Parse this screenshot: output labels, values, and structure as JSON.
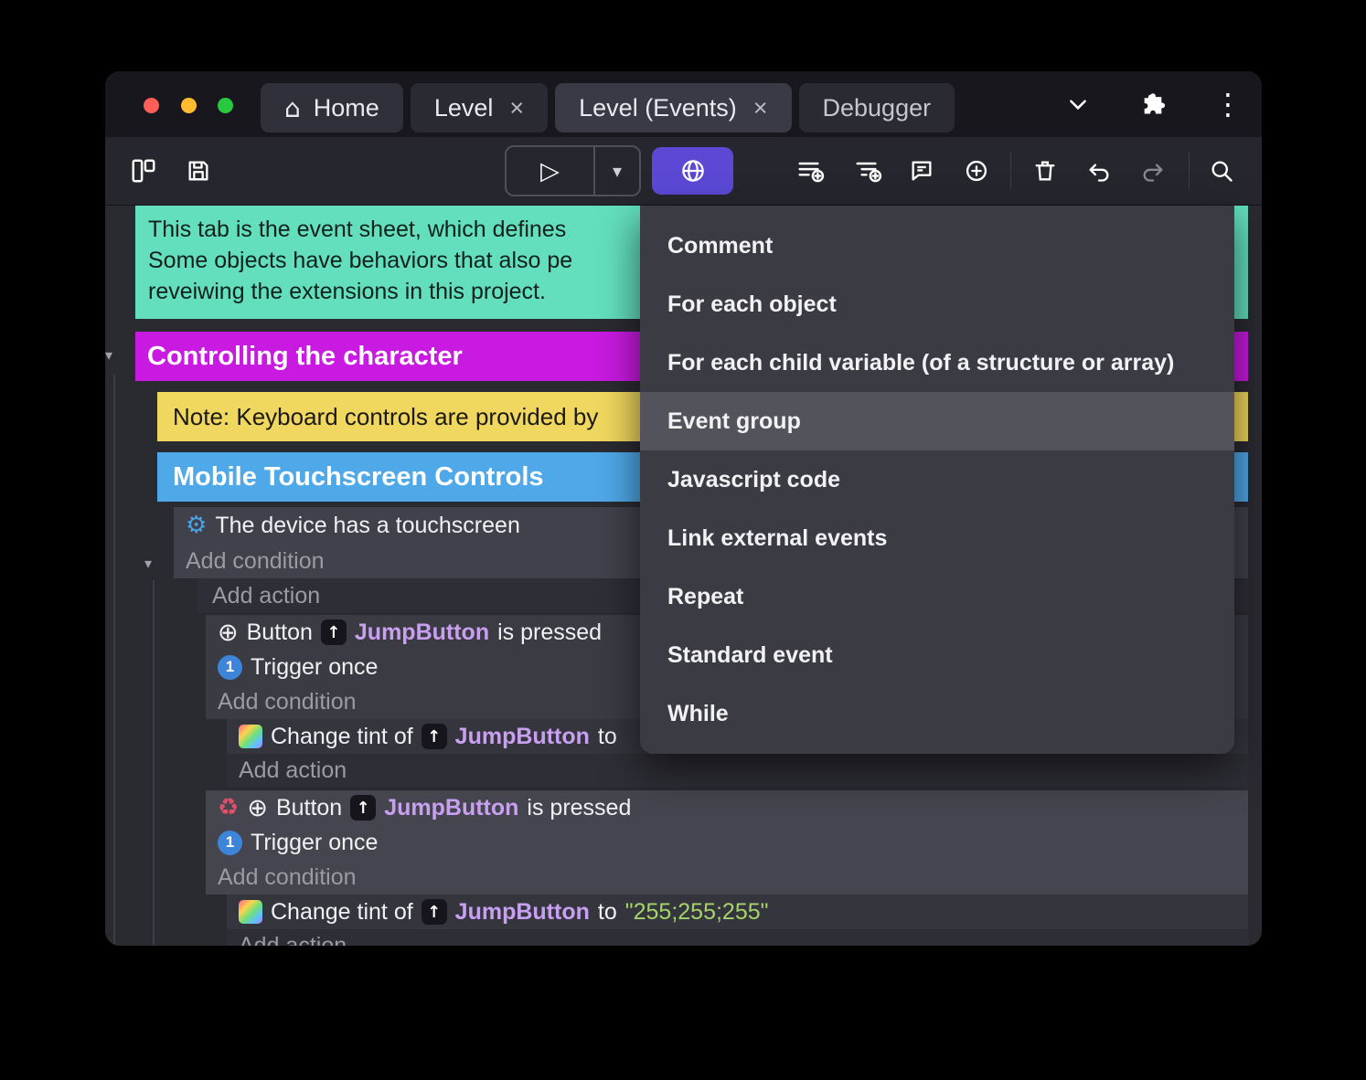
{
  "colors": {
    "accent": "#5b49d6",
    "comment-bg": "#63dfbd",
    "group1-bg": "#c81ae0",
    "note-bg": "#f0d75f",
    "group2-bg": "#4fa8e8",
    "object-text": "#c9a0f0",
    "string-text": "#a5d46a"
  },
  "icons": {
    "home": "⌂",
    "close": "×",
    "kebab": "⋮",
    "play": "▷",
    "dropdown": "▾",
    "caret": "▾",
    "gear": "⚙",
    "crosshair": "⊕",
    "uparrow": "↑",
    "one": "1",
    "recycle": "♻"
  },
  "titlebar": {
    "tabs": [
      {
        "label": "Home"
      },
      {
        "label": "Level"
      },
      {
        "label": "Level (Events)"
      },
      {
        "label": "Debugger"
      }
    ]
  },
  "menu": {
    "items": [
      "Comment",
      "For each object",
      "For each child variable (of a structure or array)",
      "Event group",
      "Javascript code",
      "Link external events",
      "Repeat",
      "Standard event",
      "While"
    ],
    "highlighted_item": "Event group"
  },
  "sheet": {
    "comment": {
      "line1": "This tab is the event sheet, which defines",
      "line2": "Some objects have behaviors that also pe",
      "line3": "reveiwing the extensions in this project."
    },
    "group_controlling": "Controlling the character",
    "note_keyboard": "Note: Keyboard controls are provided by",
    "group_mobile": "Mobile Touchscreen Controls",
    "labels": {
      "device_touchscreen": "The device has a touchscreen",
      "add_condition": "Add condition",
      "add_action": "Add action",
      "button": "Button",
      "object_name": "JumpButton",
      "is_pressed": "is pressed",
      "trigger_once": "Trigger once",
      "change_tint_of": "Change tint of",
      "to": "to",
      "tint_value": "\"255;255;255\""
    }
  }
}
